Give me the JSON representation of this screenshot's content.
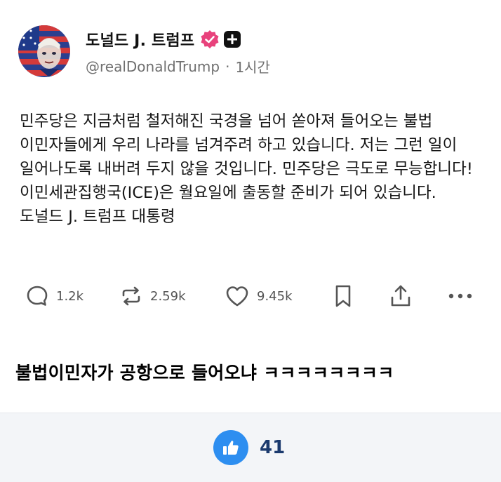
{
  "post": {
    "author": {
      "display_name": "도널드 J. 트럼프",
      "handle": "@realDonaldTrump",
      "separator": "·",
      "time_ago": "1시간",
      "avatar_icon": "flag-portrait-avatar",
      "verified_icon": "pink-verified-badge-icon",
      "verified_color": "#e8427c",
      "plus_icon": "plus-square-icon"
    },
    "text": "민주당은 지금처럼 철저해진 국경을 넘어 쏟아져 들어오는 불법 이민자들에게 우리 나라를 넘겨주려 하고 있습니다. 저는 그런 일이 일어나도록 내버려 두지 않을 것입니다. 민주당은 극도로 무능합니다! 이민세관집행국(ICE)은 월요일에 출동할 준비가 되어 있습니다. 도널드 J. 트럼프 대통령",
    "actions": {
      "reply": {
        "icon": "reply-bubble-icon",
        "count": "1.2k"
      },
      "repost": {
        "icon": "repost-arrows-icon",
        "count": "2.59k"
      },
      "like": {
        "icon": "heart-icon",
        "count": "9.45k"
      },
      "bookmark": {
        "icon": "bookmark-icon"
      },
      "share": {
        "icon": "share-upload-icon"
      },
      "more": {
        "icon": "more-dots-icon"
      }
    }
  },
  "comment": {
    "text": "불법이민자가 공항으로 들어오냐 ㅋㅋㅋㅋㅋㅋㅋㅋ"
  },
  "footer": {
    "like_icon": "thumbs-up-icon",
    "like_color": "#2d8ef0",
    "like_count": "41"
  }
}
